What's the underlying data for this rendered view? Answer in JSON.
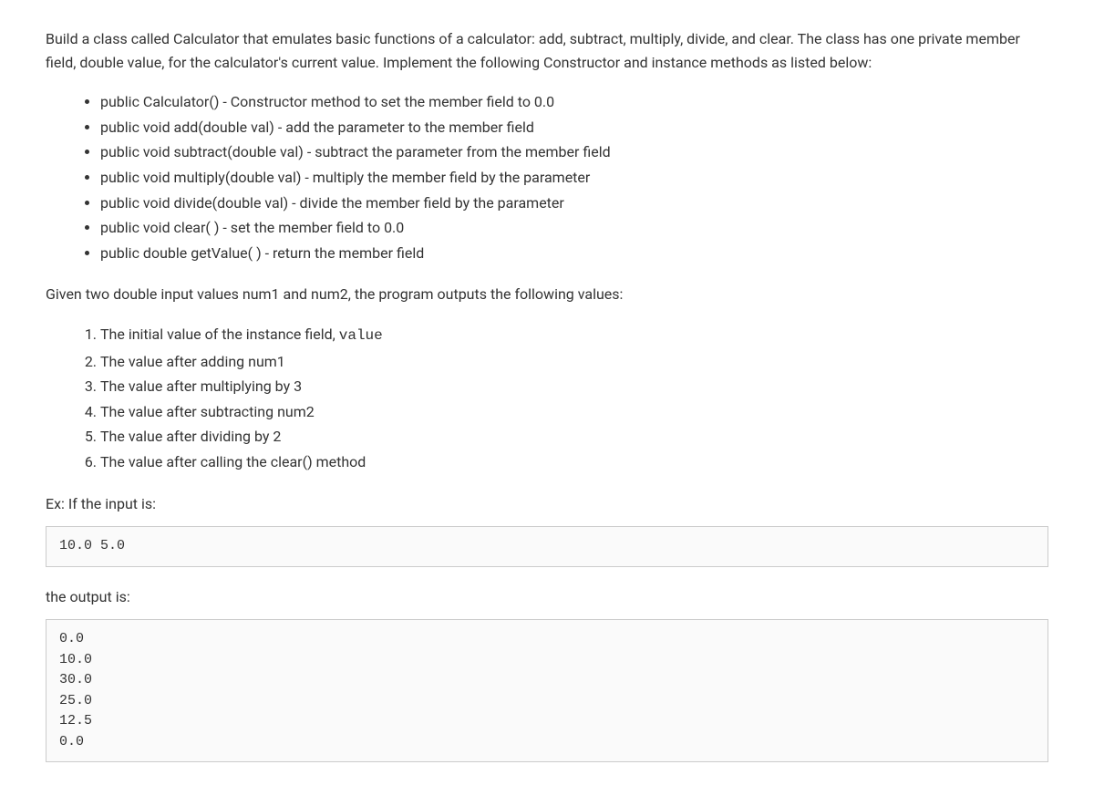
{
  "intro": "Build a class called Calculator that emulates basic functions of a calculator: add, subtract, multiply, divide, and clear. The class has one private member field, double value, for the calculator's current value. Implement the following Constructor and instance methods as listed below:",
  "bullets": [
    "public Calculator() - Constructor method to set the member field to 0.0",
    "public void add(double val) - add the parameter to the member field",
    "public void subtract(double val) - subtract the parameter from the member field",
    "public void multiply(double val) - multiply the member field by the parameter",
    "public void divide(double val) - divide the member field by the parameter",
    "public void clear( ) - set the member field to 0.0",
    "public double getValue( ) - return the member field"
  ],
  "midtext": "Given two double input values num1 and num2, the program outputs the following values:",
  "numbered_prefix": "The initial value of the instance field, ",
  "numbered_code": "value",
  "numbered_rest": [
    "The value after adding num1",
    "The value after multiplying by 3",
    "The value after subtracting num2",
    "The value after dividing by 2",
    "The value after calling the clear() method"
  ],
  "ex_label": "Ex: If the input is:",
  "input_block": "10.0 5.0",
  "output_label": "the output is:",
  "output_block": "0.0\n10.0\n30.0\n25.0\n12.5\n0.0"
}
